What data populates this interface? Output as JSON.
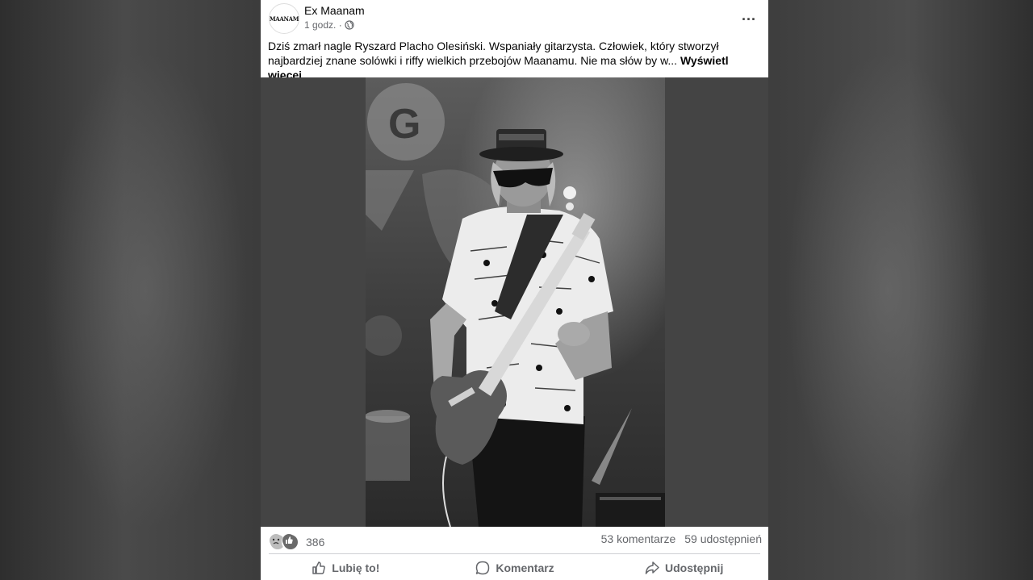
{
  "post": {
    "page_name": "Ex Maanam",
    "avatar_text": "MAANAM",
    "time": "1 godz. ·",
    "text": "Dziś zmarł nagle Ryszard Placho Olesiński. Wspaniały gitarzysta. Człowiek, który stworzył najbardziej znane solówki i riffy wielkich przebojów Maanamu. Nie ma słów by w...",
    "see_more": "Wyświetl więcej",
    "more_icon": "..."
  },
  "stats": {
    "reaction_count": "386",
    "comments": "53 komentarze",
    "shares": "59 udostępnień"
  },
  "actions": {
    "like": "Lubię to!",
    "comment": "Komentarz",
    "share": "Udostępnij"
  },
  "icons": {
    "globe": "globe-icon",
    "sad": "sad-reaction-icon",
    "like": "like-reaction-icon",
    "thumb": "thumb-up-icon",
    "comment": "comment-bubble-icon",
    "share": "share-arrow-icon"
  }
}
